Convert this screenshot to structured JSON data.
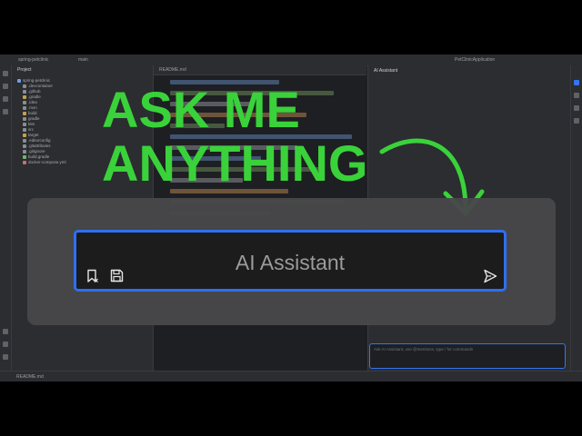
{
  "headline": {
    "line1": "ASK ME",
    "line2": "ANYTHING",
    "color": "#3ad23a"
  },
  "overlay": {
    "input_placeholder": "AI Assistant",
    "border_color": "#2e6ff0",
    "icons": [
      "bookmark-icon",
      "save-icon",
      "send-icon"
    ]
  },
  "ide": {
    "project_branch": "spring-petclinic",
    "branch": "main",
    "run_config": "PetClinicApplication",
    "panel_title": "Project",
    "assistant_title": "AI Assistant",
    "file_tab": "README.md",
    "tree": [
      {
        "label": "spring-petclinic",
        "color": "#6f9fe0"
      },
      {
        "label": ".devcontainer",
        "color": "#8a8d93"
      },
      {
        "label": ".github",
        "color": "#8a8d93"
      },
      {
        "label": ".gradle",
        "color": "#c9a04a"
      },
      {
        "label": ".idea",
        "color": "#8a8d93"
      },
      {
        "label": ".mvn",
        "color": "#8a8d93"
      },
      {
        "label": "build",
        "color": "#c9a04a"
      },
      {
        "label": "gradle",
        "color": "#8a8d93"
      },
      {
        "label": "k8s",
        "color": "#8a8d93"
      },
      {
        "label": "src",
        "color": "#8a8d93"
      },
      {
        "label": "target",
        "color": "#c9a04a"
      },
      {
        "label": ".editorconfig",
        "color": "#8a8d93"
      },
      {
        "label": ".gitattributes",
        "color": "#8a8d93"
      },
      {
        "label": ".gitignore",
        "color": "#8a8d93"
      },
      {
        "label": "build.gradle",
        "color": "#6fb86f"
      },
      {
        "label": "docker-compose.yml",
        "color": "#d06d6d"
      }
    ],
    "mini_input_placeholder": "Ask AI Assistant, use @mentions, type / for commands",
    "status_file": "README.md"
  }
}
